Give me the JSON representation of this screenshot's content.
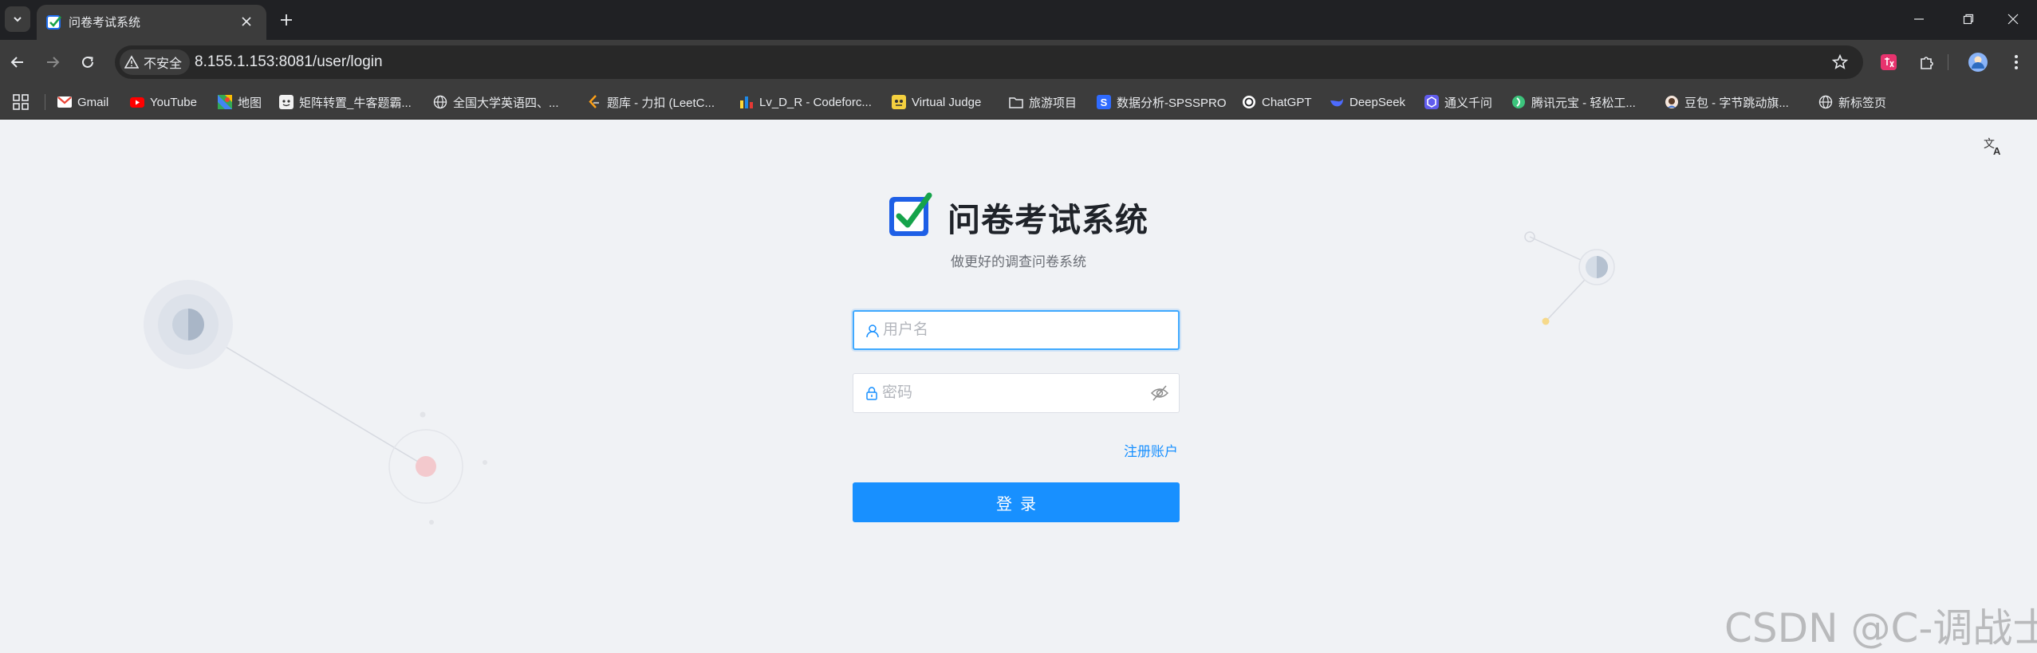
{
  "browser": {
    "tab_title": "问卷考试系统",
    "security_label": "不安全",
    "url": "8.155.1.153:8081/user/login",
    "bookmarks": [
      {
        "label": "Gmail",
        "icon": "gmail-icon"
      },
      {
        "label": "YouTube",
        "icon": "youtube-icon"
      },
      {
        "label": "地图",
        "icon": "maps-icon"
      },
      {
        "label": "矩阵转置_牛客题霸...",
        "icon": "nowcoder-icon"
      },
      {
        "label": "全国大学英语四、...",
        "icon": "globe-icon"
      },
      {
        "label": "题库 - 力扣 (LeetC...",
        "icon": "leetcode-icon"
      },
      {
        "label": "Lv_D_R - Codeforc...",
        "icon": "codeforces-icon"
      },
      {
        "label": "Virtual Judge",
        "icon": "vjudge-icon"
      },
      {
        "label": "旅游项目",
        "icon": "folder-icon"
      },
      {
        "label": "数据分析-SPSSPRO",
        "icon": "spsspro-icon"
      },
      {
        "label": "ChatGPT",
        "icon": "chatgpt-icon"
      },
      {
        "label": "DeepSeek",
        "icon": "deepseek-icon"
      },
      {
        "label": "通义千问",
        "icon": "tongyi-icon"
      },
      {
        "label": "腾讯元宝 - 轻松工...",
        "icon": "yuanbao-icon"
      },
      {
        "label": "豆包 - 字节跳动旗...",
        "icon": "doubao-icon"
      },
      {
        "label": "新标签页",
        "icon": "globe-icon"
      }
    ]
  },
  "login": {
    "title": "问卷考试系统",
    "subtitle": "做更好的调查问卷系统",
    "username_placeholder": "用户名",
    "password_placeholder": "密码",
    "register_link": "注册账户",
    "login_button": "登录"
  },
  "watermark": "CSDN @C-调战士",
  "colors": {
    "primary": "#1890ff",
    "page_background": "#f0f2f5",
    "browser_chrome": "#3c3c3c"
  }
}
